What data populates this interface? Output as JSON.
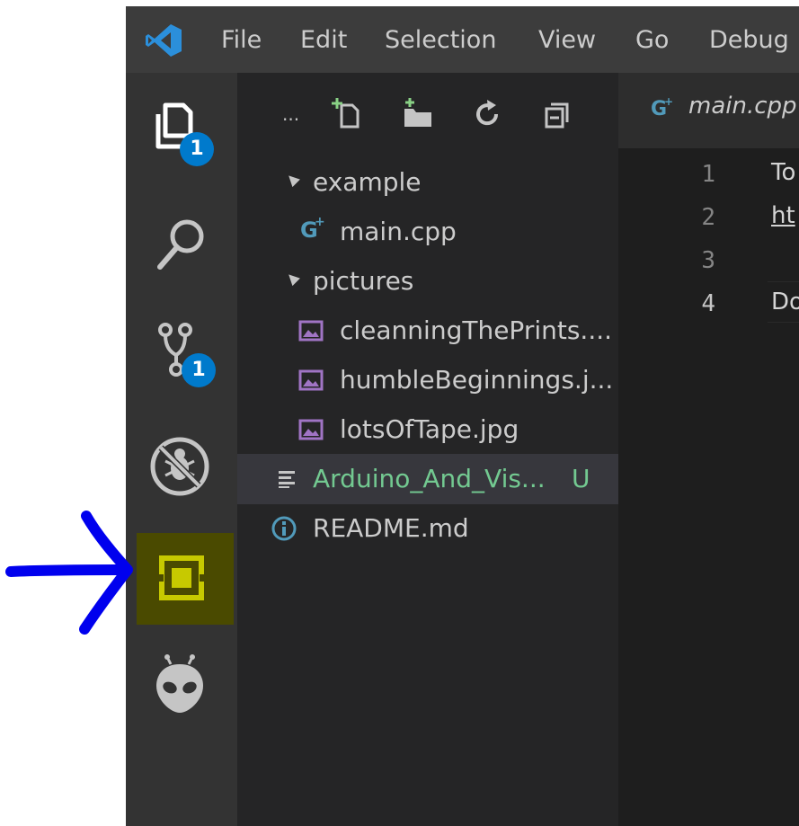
{
  "titlebar": {
    "menu": [
      "File",
      "Edit",
      "Selection",
      "View",
      "Go",
      "Debug"
    ]
  },
  "activity_bar": {
    "explorer_badge": "1",
    "scm_badge": "1"
  },
  "sidebar": {
    "toolbar_more": "...",
    "tree": {
      "folder_example": "example",
      "file_main": "main.cpp",
      "folder_pictures": "pictures",
      "file_cleaning": "cleanningThePrints....",
      "file_humble": "humbleBeginnings.j...",
      "file_tape": "lotsOfTape.jpg",
      "file_arduino": "Arduino_And_Vis...",
      "file_arduino_status": "U",
      "file_readme": "README.md"
    }
  },
  "editor": {
    "tab_label": "main.cpp",
    "line_numbers": [
      "1",
      "2",
      "3",
      "4"
    ],
    "lines": [
      "To",
      "ht",
      "",
      "Do"
    ]
  },
  "colors": {
    "accent": "#007acc",
    "untracked_green": "#73c991",
    "highlight_yellow": "#bfc000",
    "annotation_blue": "#0000ee",
    "image_icon_purple": "#a074c4",
    "cpp_icon_blue": "#519aba"
  },
  "icons": {
    "logo": "vscode-logo-icon",
    "explorer": "files-icon",
    "search": "search-icon",
    "scm": "source-control-icon",
    "debug": "no-bug-icon",
    "extension_highlighted": "bracketed-square-extension-icon",
    "platformio": "alien-head-icon",
    "annotation": "hand-drawn-arrow-icon"
  }
}
